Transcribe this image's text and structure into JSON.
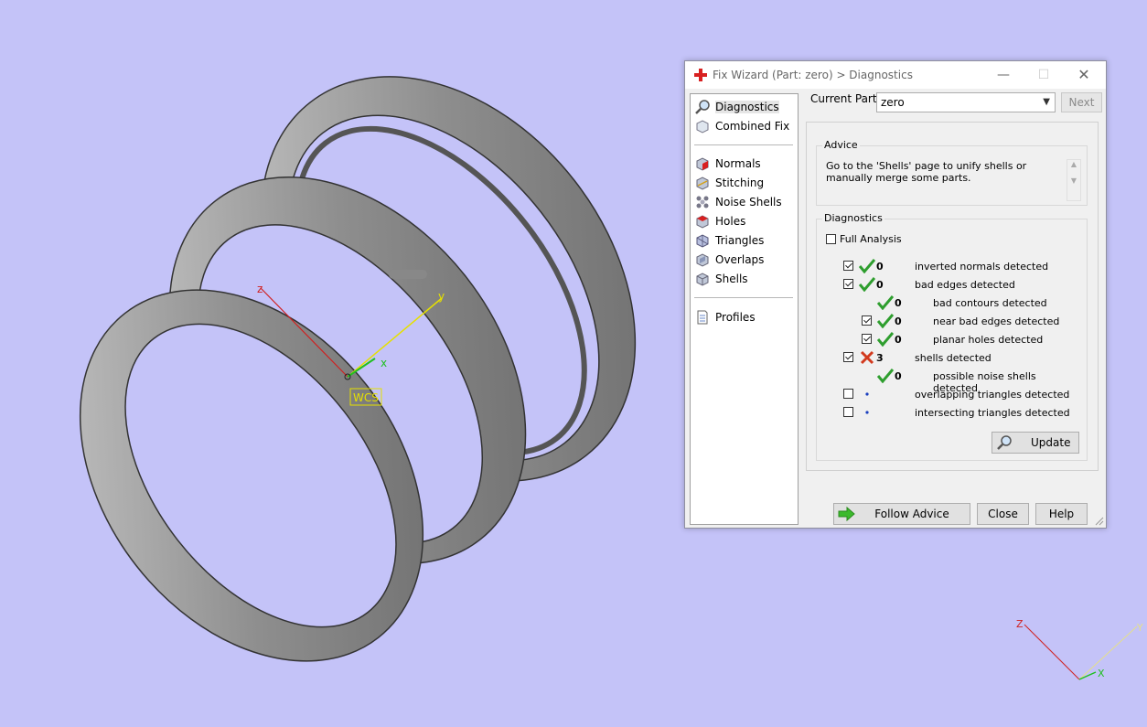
{
  "viewport": {
    "label_wcs": "WCS",
    "axis_x": "x",
    "axis_y": "y",
    "axis_z": "z",
    "corner_axes": {
      "x": "X",
      "y": "Y",
      "z": "Z"
    },
    "background": "#c4c3f8",
    "model_color": "#9a9a9a"
  },
  "dialog": {
    "title": "Fix Wizard (Part: zero) > Diagnostics",
    "nav": [
      {
        "label": "Diagnostics",
        "icon": "magnifier-icon",
        "active": true
      },
      {
        "label": "Combined Fix",
        "icon": "cube-icon"
      },
      {
        "label": "Normals",
        "icon": "normals-cube-icon"
      },
      {
        "label": "Stitching",
        "icon": "stitching-cube-icon"
      },
      {
        "label": "Noise Shells",
        "icon": "noise-shells-icon"
      },
      {
        "label": "Holes",
        "icon": "holes-cube-icon"
      },
      {
        "label": "Triangles",
        "icon": "triangles-cube-icon"
      },
      {
        "label": "Overlaps",
        "icon": "overlaps-cube-icon"
      },
      {
        "label": "Shells",
        "icon": "shells-cube-icon"
      },
      {
        "label": "Profiles",
        "icon": "document-icon"
      }
    ],
    "current_part_label": "Current Part:",
    "current_part_value": "zero",
    "next_label": "Next",
    "advice": {
      "title": "Advice",
      "text": "Go to the 'Shells' page to unify shells or manually merge some parts."
    },
    "diagnostics": {
      "title": "Diagnostics",
      "full_analysis_label": "Full Analysis",
      "full_analysis_checked": false,
      "rows": [
        {
          "checked": true,
          "status": "ok",
          "value": "0",
          "label": "inverted normals detected",
          "indent": 0
        },
        {
          "checked": true,
          "status": "ok",
          "value": "0",
          "label": "bad edges detected",
          "indent": 0
        },
        {
          "checkbox": false,
          "status": "ok",
          "value": "0",
          "label": "bad contours detected",
          "indent": 1
        },
        {
          "checked": true,
          "status": "ok",
          "value": "0",
          "label": "near bad edges detected",
          "indent": 1
        },
        {
          "checked": true,
          "status": "ok",
          "value": "0",
          "label": "planar holes detected",
          "indent": 1
        },
        {
          "checked": true,
          "status": "bad",
          "value": "3",
          "label": "shells detected",
          "indent": 0
        },
        {
          "checkbox": false,
          "status": "ok",
          "value": "0",
          "label": "possible noise shells detected",
          "indent": 1
        },
        {
          "checked": false,
          "status": "dot",
          "value": "",
          "label": "overlapping triangles detected",
          "indent": 0
        },
        {
          "checked": false,
          "status": "dot",
          "value": "",
          "label": "intersecting triangles detected",
          "indent": 0
        }
      ],
      "update_label": "Update"
    },
    "buttons": {
      "follow_advice": "Follow Advice",
      "close": "Close",
      "help": "Help"
    },
    "colors": {
      "ok": "#2e9e2e",
      "bad": "#d23a1e",
      "dot": "#1a3fbf",
      "icon_red": "#d82020"
    }
  }
}
